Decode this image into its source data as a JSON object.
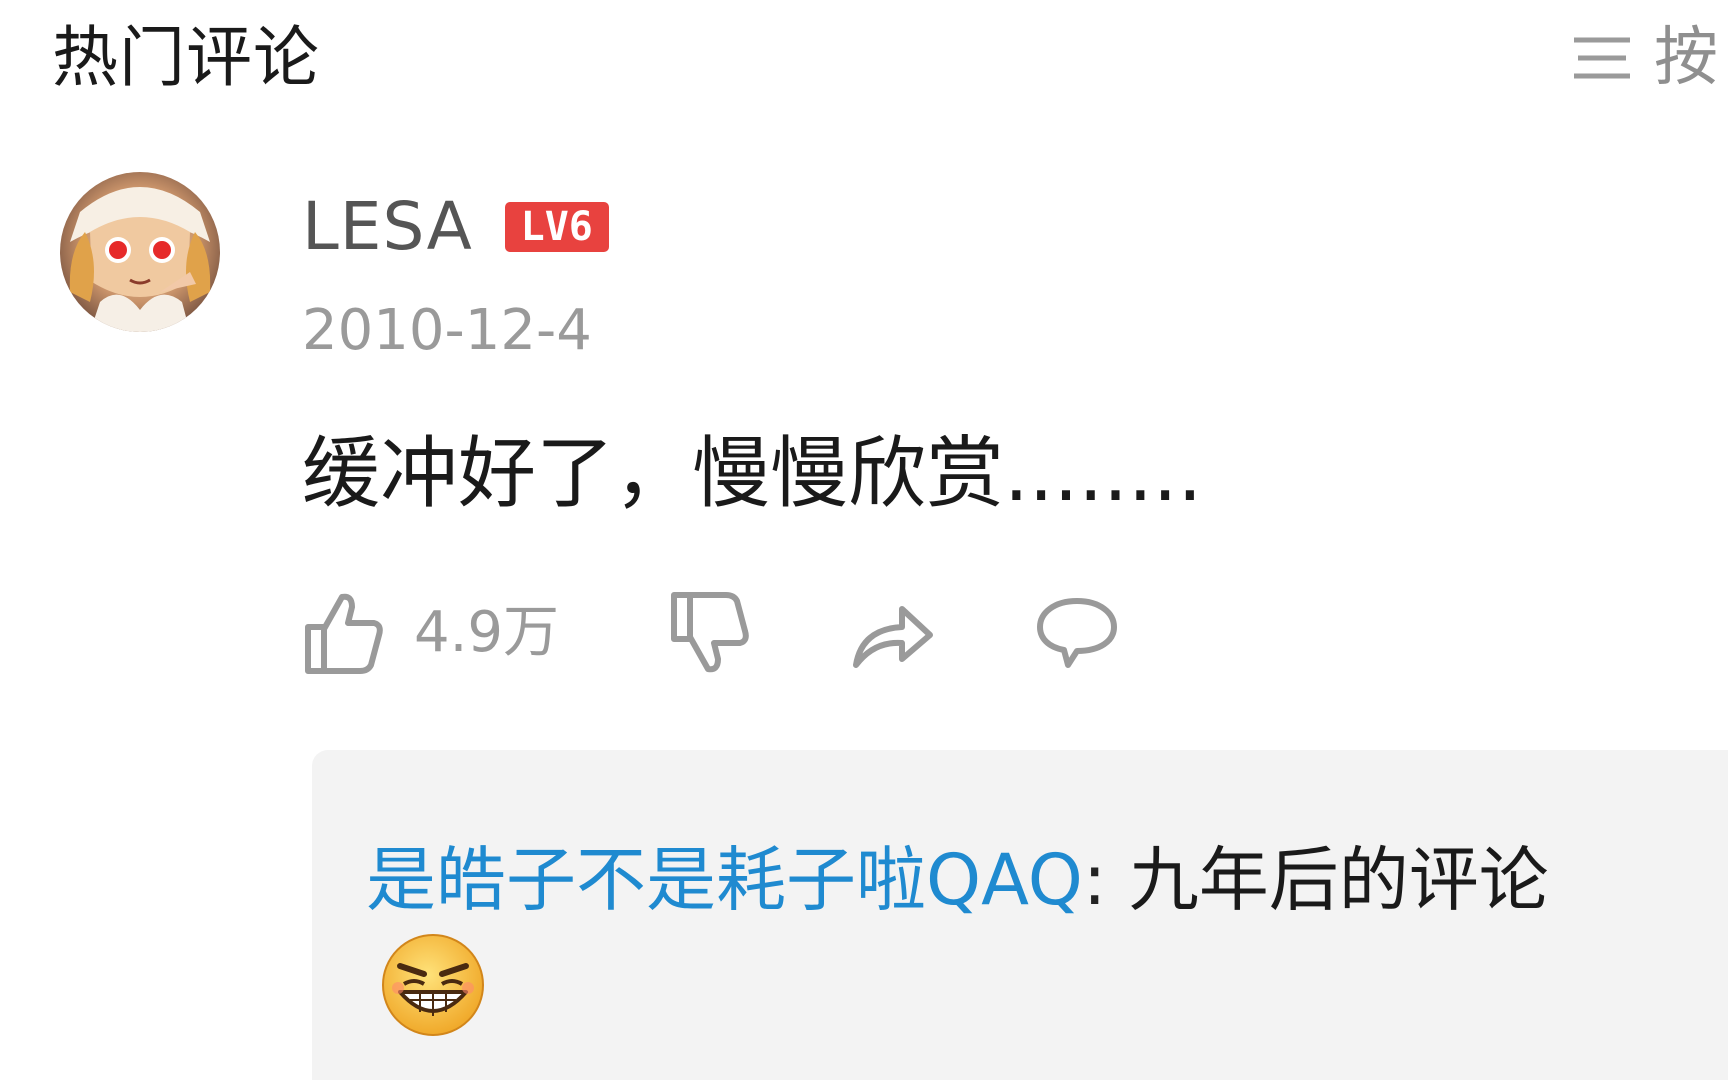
{
  "header": {
    "title": "热门评论",
    "sort_label": "按"
  },
  "comment": {
    "username": "LESA",
    "level_badge": "LV6",
    "date": "2010-12-4",
    "text": "缓冲好了，慢慢欣赏........",
    "like_count": "4.9万"
  },
  "reply": {
    "user": "是皓子不是耗子啦QAQ",
    "colon": ":",
    "text": " 九年后的评论"
  },
  "colors": {
    "accent_link": "#1f8ad0",
    "level_badge": "#e8423f",
    "meta_gray": "#9a9a9a",
    "reply_background": "#f3f3f3"
  },
  "icons": {
    "sort": "menu-lines-icon",
    "like": "thumbs-up-icon",
    "dislike": "thumbs-down-icon",
    "share": "share-arrow-icon",
    "reply": "speech-bubble-icon",
    "emoji": "grinning-face-emoji"
  }
}
